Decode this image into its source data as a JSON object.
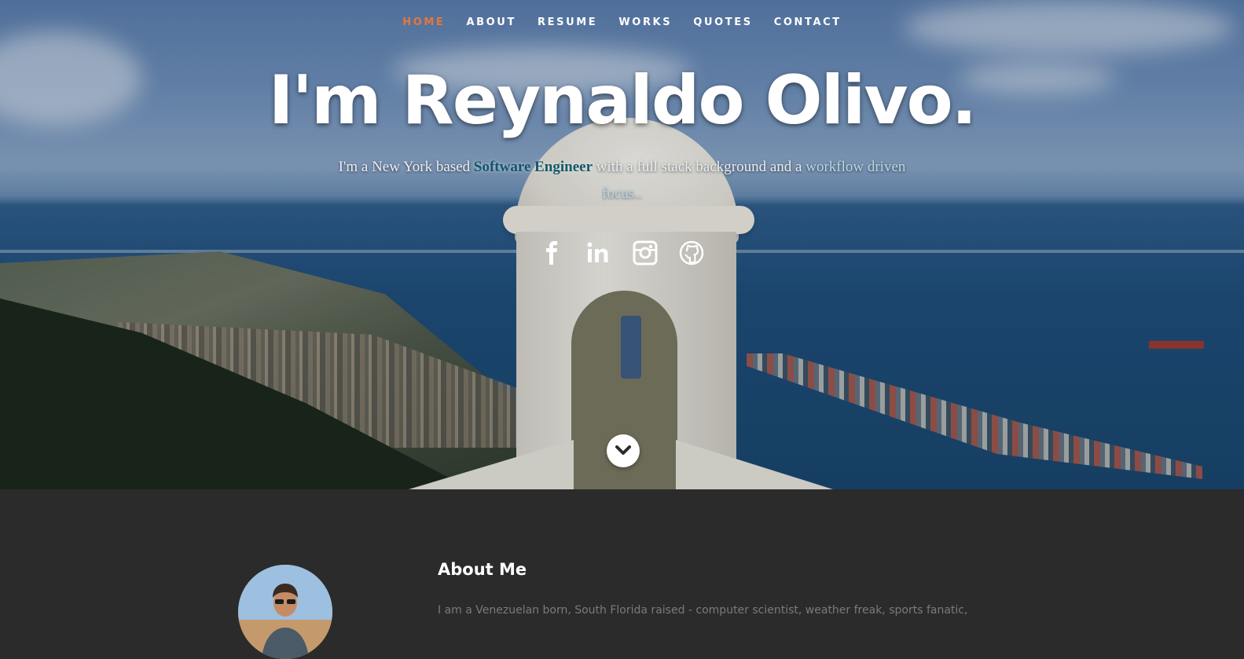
{
  "nav": {
    "items": [
      {
        "label": "HOME",
        "active": true
      },
      {
        "label": "ABOUT",
        "active": false
      },
      {
        "label": "RESUME",
        "active": false
      },
      {
        "label": "WORKS",
        "active": false
      },
      {
        "label": "QUOTES",
        "active": false
      },
      {
        "label": "CONTACT",
        "active": false
      }
    ],
    "active_color": "#e8763a"
  },
  "hero": {
    "headline": "I'm Reynaldo Olivo.",
    "intro_prefix": "I'm a New York based ",
    "intro_highlight": "Software Engineer",
    "intro_middle": " with a full stack background and a ",
    "intro_soft": "workflow driven focus..",
    "social_icons": [
      "facebook-icon",
      "linkedin-icon",
      "instagram-icon",
      "github-icon"
    ],
    "scroll_icon": "chevron-down-icon"
  },
  "about": {
    "title": "About Me",
    "text": "I am a Venezuelan born, South Florida raised - computer scientist, weather freak, sports fanatic,"
  },
  "colors": {
    "highlight": "#11576b",
    "section_bg": "#2b2b2b",
    "body_text": "#7a7a7a"
  }
}
